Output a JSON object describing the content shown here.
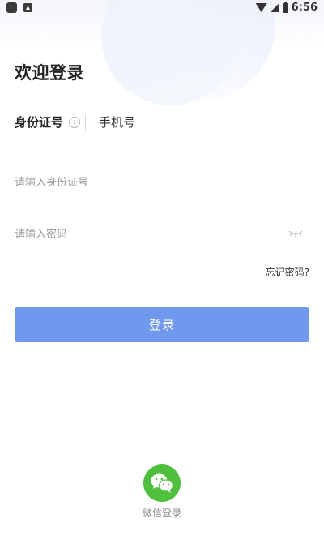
{
  "status_bar": {
    "time": "6:56"
  },
  "title": "欢迎登录",
  "tabs": {
    "id_card": "身份证号",
    "phone": "手机号"
  },
  "form": {
    "id_placeholder": "请输入身份证号",
    "password_placeholder": "请输入密码",
    "forgot_password": "忘记密码?",
    "login_button": "登录"
  },
  "wechat": {
    "label": "微信登录"
  },
  "colors": {
    "primary_button": "#6f99ec",
    "wechat_green": "#4fbf3d"
  },
  "icons": [
    "app-icon",
    "notification-icon",
    "wifi-icon",
    "signal-icon",
    "battery-icon",
    "info-icon",
    "eye-closed-icon",
    "wechat-icon"
  ]
}
